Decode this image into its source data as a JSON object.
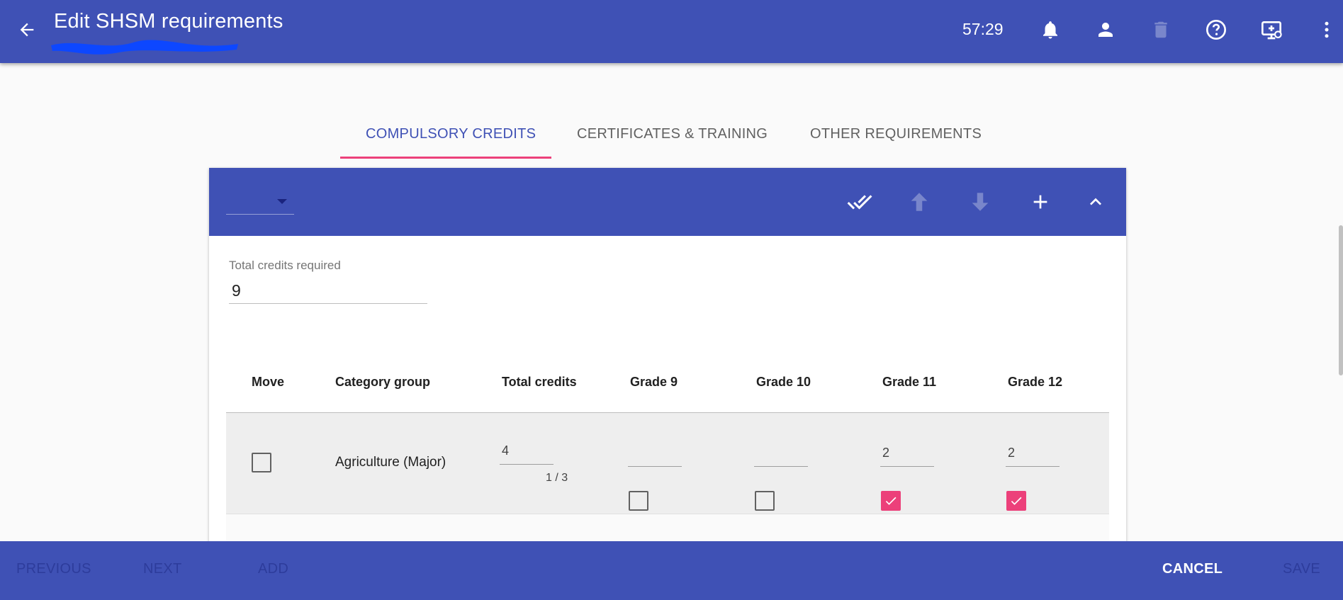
{
  "appbar": {
    "title": "Edit SHSM requirements",
    "timer": "57:29",
    "icons": [
      "back-arrow-icon",
      "bell-icon",
      "person-icon",
      "trash-icon",
      "help-icon",
      "screen-share-icon",
      "more-vert-icon"
    ]
  },
  "tabs": [
    {
      "label": "COMPULSORY CREDITS",
      "active": true
    },
    {
      "label": "CERTIFICATES & TRAINING",
      "active": false
    },
    {
      "label": "OTHER REQUIREMENTS",
      "active": false
    }
  ],
  "card": {
    "select_value": "",
    "toolbar_icons": [
      "double-check-icon",
      "arrow-up-icon",
      "arrow-down-icon",
      "plus-icon",
      "chevron-up-icon"
    ],
    "total_credits": {
      "label": "Total credits required",
      "value": "9"
    },
    "table": {
      "headers": [
        "Move",
        "Category group",
        "Total credits",
        "Grade 9",
        "Grade 10",
        "Grade 11",
        "Grade 12"
      ],
      "rows": [
        {
          "move_checked": false,
          "category_group": "Agriculture (Major)",
          "total_credits": "4",
          "credits_hint": "1 / 3",
          "grade9": {
            "value": "",
            "checked": false
          },
          "grade10": {
            "value": "",
            "checked": false
          },
          "grade11": {
            "value": "2",
            "checked": true
          },
          "grade12": {
            "value": "2",
            "checked": true
          }
        }
      ]
    }
  },
  "bottombar": {
    "previous": "PREVIOUS",
    "next": "NEXT",
    "add": "ADD",
    "cancel": "CANCEL",
    "save": "SAVE"
  },
  "colors": {
    "primary": "#3f51b5",
    "accent": "#ec407a"
  }
}
